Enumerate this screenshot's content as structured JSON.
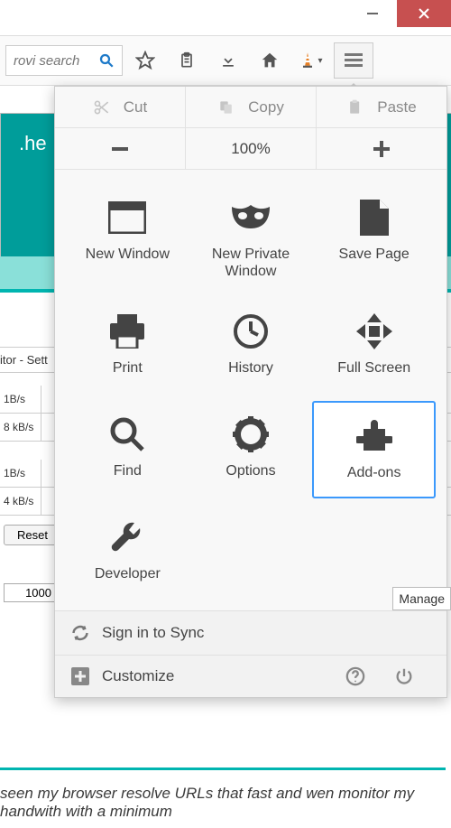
{
  "titlebar": {
    "minimize": "—",
    "close": "✕"
  },
  "toolbar": {
    "search_placeholder": "rovi search",
    "vlc_dropdown": "▾"
  },
  "bg": {
    "teal_title": ".he",
    "settings_label": "itor - Sett",
    "row1a": "1B/s",
    "row1b": "8 kB/s",
    "row2a": "1B/s",
    "row2b": "4 kB/s",
    "reset": "Reset",
    "value": "1000",
    "testimonial": "seen my browser resolve URLs that fast and wen monitor my handwith with a minimum"
  },
  "menu": {
    "cut": "Cut",
    "copy": "Copy",
    "paste": "Paste",
    "zoom": "100%",
    "items": [
      {
        "label": "New Window"
      },
      {
        "label": "New Private Window"
      },
      {
        "label": "Save Page"
      },
      {
        "label": "Print"
      },
      {
        "label": "History"
      },
      {
        "label": "Full Screen"
      },
      {
        "label": "Find"
      },
      {
        "label": "Options"
      },
      {
        "label": "Add-ons"
      },
      {
        "label": "Developer"
      }
    ],
    "sign_in": "Sign in to Sync",
    "customize": "Customize",
    "tooltip": "Manage"
  }
}
